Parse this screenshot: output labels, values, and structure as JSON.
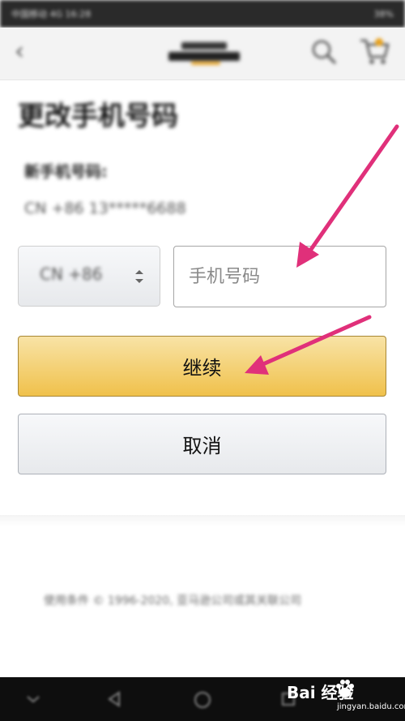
{
  "status_bar": {
    "left": "中国移动 4G 16:28",
    "right": "38%"
  },
  "header": {
    "back_icon": "chevron-left-icon",
    "logo": "amazon-logo",
    "search_icon": "search-icon",
    "cart_icon": "cart-icon"
  },
  "page": {
    "title": "更改手机号码",
    "current_label": "新手机号码:",
    "current_value": "CN +86 13*****6688"
  },
  "form": {
    "country_code": "CN +86",
    "phone_placeholder": "手机号码",
    "phone_value": "",
    "continue_label": "继续",
    "cancel_label": "取消"
  },
  "footer": {
    "text": "使用条件 © 1996-2020, 亚马逊公司或其关联公司"
  },
  "watermark": {
    "brand": "Bai 经验",
    "url": "jingyan.baidu.com"
  },
  "colors": {
    "accent_yellow": "#f0c14b",
    "arrow_pink": "#e0307a",
    "header_bg": "#f3f3f3",
    "navbar_bg": "#0e0e0e"
  }
}
